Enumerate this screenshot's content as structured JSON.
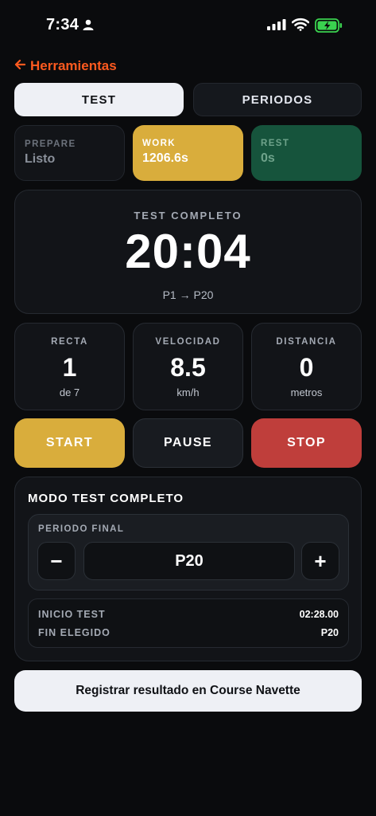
{
  "status": {
    "time": "7:34"
  },
  "nav": {
    "back_label": "Herramientas"
  },
  "segments": [
    {
      "label": "TEST",
      "active": true
    },
    {
      "label": "PERIODOS",
      "active": false
    }
  ],
  "phases": [
    {
      "label": "PREPARE",
      "value": "Listo",
      "color": "#121418"
    },
    {
      "label": "WORK",
      "value": "1206.6s",
      "color": "#d9ad3c"
    },
    {
      "label": "REST",
      "value": "0s",
      "color": "#16543c"
    }
  ],
  "timer": {
    "title": "TEST COMPLETO",
    "time": "20:04",
    "range": "P1 → P20"
  },
  "stats": [
    {
      "label": "RECTA",
      "value": "1",
      "unit": "de 7"
    },
    {
      "label": "VELOCIDAD",
      "value": "8.5",
      "unit": "km/h"
    },
    {
      "label": "DISTANCIA",
      "value": "0",
      "unit": "metros"
    }
  ],
  "controls": {
    "start": "START",
    "pause": "PAUSE",
    "stop": "STOP"
  },
  "mode": {
    "title": "MODO TEST COMPLETO",
    "final_period_label": "PERIODO FINAL",
    "minus": "−",
    "plus": "+",
    "final_period_value": "P20",
    "info": [
      {
        "key": "INICIO TEST",
        "value": "02:28.00"
      },
      {
        "key": "FIN ELEGIDO",
        "value": "P20"
      }
    ]
  },
  "register_label": "Registrar resultado en Course Navette",
  "colors": {
    "accent": "#ff5a1f",
    "work": "#d9ad3c",
    "rest": "#16543c",
    "stop": "#bf3e3b"
  },
  "icons": [
    "person-icon",
    "signal-icon",
    "wifi-icon",
    "battery-charging-icon",
    "arrow-left-icon"
  ]
}
